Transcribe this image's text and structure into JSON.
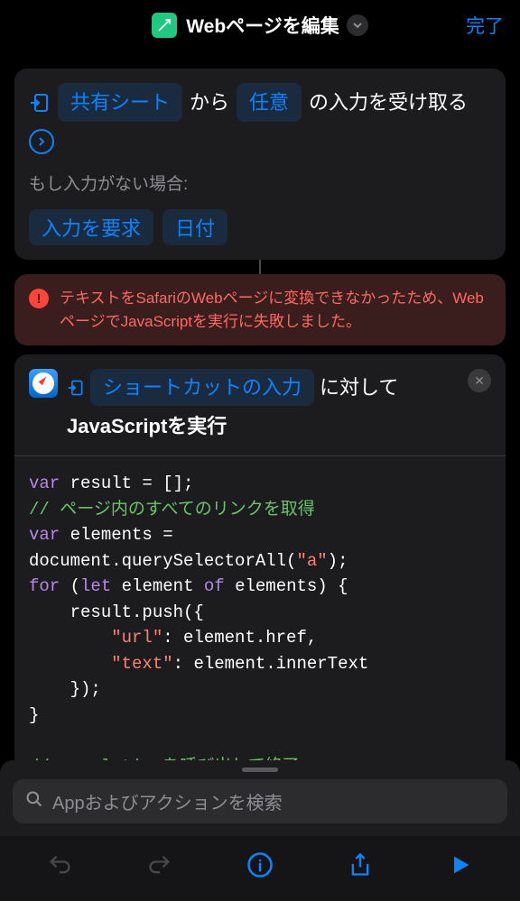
{
  "header": {
    "title": "Webページを編集",
    "done": "完了"
  },
  "inputCard": {
    "shareSheet": "共有シート",
    "from": "から",
    "any": "任意",
    "receiveInput": "の入力を受け取る",
    "ifNoInput": "もし入力がない場合:",
    "askForInput": "入力を要求",
    "date": "日付"
  },
  "error": {
    "message": "テキストをSafariのWebページに変換できなかったため、WebページでJavaScriptを実行に失敗しました。"
  },
  "jsCard": {
    "shortcutInput": "ショートカットの入力",
    "against": "に対して",
    "runJs": "JavaScriptを実行"
  },
  "code": {
    "l1a": "var",
    "l1b": " result = [];",
    "l2": "// ページ内のすべてのリンクを取得",
    "l3a": "var",
    "l3b": " elements =",
    "l4a": "document.querySelectorAll(",
    "l4b": "\"a\"",
    "l4c": ");",
    "l5a": "for",
    "l5b": " (",
    "l5c": "let",
    "l5d": " element ",
    "l5e": "of",
    "l5f": " elements) {",
    "l6": "    result.push({",
    "l7a": "        ",
    "l7b": "\"url\"",
    "l7c": ": element.href,",
    "l8a": "        ",
    "l8b": "\"text\"",
    "l8c": ": element.innerText",
    "l9": "    });",
    "l10": "}",
    "l11": "",
    "l12": "// completionを呼び出して終了"
  },
  "search": {
    "placeholder": "Appおよびアクションを検索"
  }
}
